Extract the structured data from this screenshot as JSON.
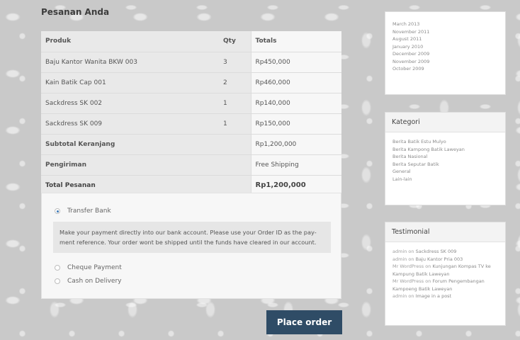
{
  "order": {
    "title": "Pesanan Anda",
    "headers": {
      "product": "Produk",
      "qty": "Qty",
      "totals": "Totals"
    },
    "items": [
      {
        "product": "Baju Kantor Wanita BKW 003",
        "qty": "3",
        "total": "Rp450,000"
      },
      {
        "product": "Kain Batik Cap 001",
        "qty": "2",
        "total": "Rp460,000"
      },
      {
        "product": "Sackdress SK 002",
        "qty": "1",
        "total": "Rp140,000"
      },
      {
        "product": "Sackdress SK 009",
        "qty": "1",
        "total": "Rp150,000"
      }
    ],
    "subtotal": {
      "label": "Subtotal Keranjang",
      "value": "Rp1,200,000"
    },
    "shipping": {
      "label": "Pengiriman",
      "value": "Free Shipping"
    },
    "total": {
      "label": "Total Pesanan",
      "value": "Rp1,200,000"
    }
  },
  "payment": {
    "options": [
      {
        "label": "Transfer Bank",
        "checked": true
      },
      {
        "label": "Cheque Payment",
        "checked": false
      },
      {
        "label": "Cash on Delivery",
        "checked": false
      }
    ],
    "description": "Make your payment directly into our bank account. Please use your Order ID as the pay-ment reference. Your order wont be shipped until the funds have cleared in our account.",
    "place_order_label": "Place order"
  },
  "sidebar": {
    "archives": [
      "March 2013",
      "November 2011",
      "August 2011",
      "January 2010",
      "December 2009",
      "November 2009",
      "October 2009"
    ],
    "categories": {
      "title": "Kategori",
      "items": [
        "Berita Batik Estu Mulyo",
        "Berita Kampong Batik Laweyan",
        "Berita Nasional",
        "Berita Seputar Batik",
        "General",
        "Lain-lain"
      ]
    },
    "testimonial": {
      "title": "Testimonial",
      "items": [
        {
          "who": "admin on",
          "what": "Sackdress SK 009"
        },
        {
          "who": "admin on",
          "what": "Baju Kantor Pria 003"
        },
        {
          "who": "Mr WordPress on",
          "what": "Kunjungan Kompas TV ke Kampung Batik Laweyan"
        },
        {
          "who": "Mr WordPress on",
          "what": "Forum Pengembangan Kampoeng Batik Laweyan"
        },
        {
          "who": "admin on",
          "what": "Image in a post"
        }
      ]
    }
  }
}
